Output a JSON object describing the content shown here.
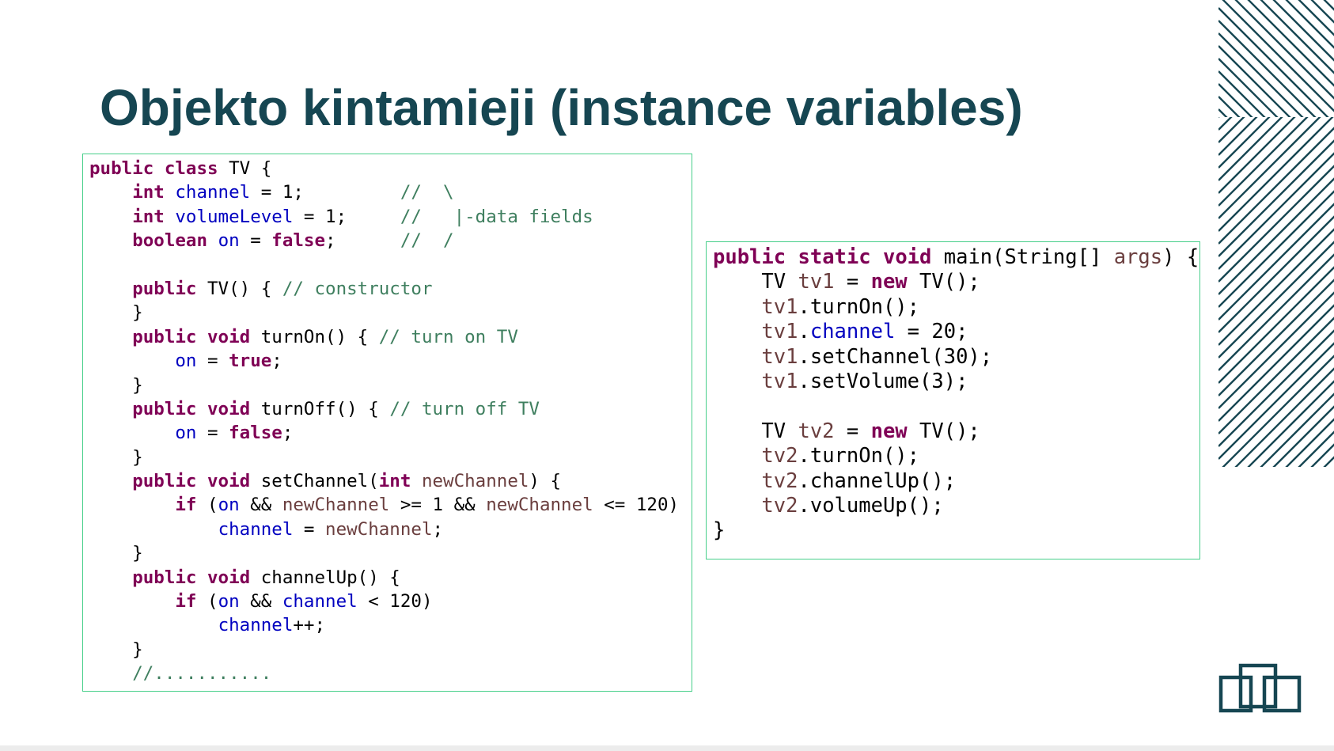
{
  "slide": {
    "title": "Objekto kintamieji (instance variables)"
  },
  "code_class": {
    "l1": {
      "t1": "public",
      "t2": " ",
      "t3": "class",
      "t4": " TV {"
    },
    "l2": {
      "t1": "    ",
      "t2": "int",
      "t3": " ",
      "t4": "channel",
      "t5": " = 1;         ",
      "t6": "//  \\"
    },
    "l3": {
      "t1": "    ",
      "t2": "int",
      "t3": " ",
      "t4": "volumeLevel",
      "t5": " = 1;     ",
      "t6": "//   |-data fields"
    },
    "l4": {
      "t1": "    ",
      "t2": "boolean",
      "t3": " ",
      "t4": "on",
      "t5": " = ",
      "t6": "false",
      "t7": ";      ",
      "t8": "//  /"
    },
    "l5": {
      "t1": ""
    },
    "l6": {
      "t1": "    ",
      "t2": "public",
      "t3": " TV() { ",
      "t4": "// constructor"
    },
    "l7": {
      "t1": "    }"
    },
    "l8": {
      "t1": "    ",
      "t2": "public",
      "t3": " ",
      "t4": "void",
      "t5": " turnOn() { ",
      "t6": "// turn on TV"
    },
    "l9": {
      "t1": "        ",
      "t2": "on",
      "t3": " = ",
      "t4": "true",
      "t5": ";"
    },
    "l10": {
      "t1": "    }"
    },
    "l11": {
      "t1": "    ",
      "t2": "public",
      "t3": " ",
      "t4": "void",
      "t5": " turnOff() { ",
      "t6": "// turn off TV"
    },
    "l12": {
      "t1": "        ",
      "t2": "on",
      "t3": " = ",
      "t4": "false",
      "t5": ";"
    },
    "l13": {
      "t1": "    }"
    },
    "l14": {
      "t1": "    ",
      "t2": "public",
      "t3": " ",
      "t4": "void",
      "t5": " setChannel(",
      "t6": "int",
      "t7": " ",
      "t8": "newChannel",
      "t9": ") {"
    },
    "l15": {
      "t1": "        ",
      "t2": "if",
      "t3": " (",
      "t4": "on",
      "t5": " && ",
      "t6": "newChannel",
      "t7": " >= 1 && ",
      "t8": "newChannel",
      "t9": " <= 120)"
    },
    "l16": {
      "t1": "            ",
      "t2": "channel",
      "t3": " = ",
      "t4": "newChannel",
      "t5": ";"
    },
    "l17": {
      "t1": "    }"
    },
    "l18": {
      "t1": "    ",
      "t2": "public",
      "t3": " ",
      "t4": "void",
      "t5": " channelUp() {"
    },
    "l19": {
      "t1": "        ",
      "t2": "if",
      "t3": " (",
      "t4": "on",
      "t5": " && ",
      "t6": "channel",
      "t7": " < 120)"
    },
    "l20": {
      "t1": "            ",
      "t2": "channel",
      "t3": "++;"
    },
    "l21": {
      "t1": "    }"
    },
    "l22": {
      "t1": "    ",
      "t2": "//..........."
    }
  },
  "code_main": {
    "l1": {
      "t1": "public",
      "t2": " ",
      "t3": "static",
      "t4": " ",
      "t5": "void",
      "t6": " main(String[] ",
      "t7": "args",
      "t8": ") {"
    },
    "l2": {
      "t1": "    TV ",
      "t2": "tv1",
      "t3": " = ",
      "t4": "new",
      "t5": " TV();"
    },
    "l3": {
      "t1": "    ",
      "t2": "tv1",
      "t3": ".turnOn();"
    },
    "l4": {
      "t1": "    ",
      "t2": "tv1",
      "t3": ".",
      "t4": "channel",
      "t5": " = 20;"
    },
    "l5": {
      "t1": "    ",
      "t2": "tv1",
      "t3": ".setChannel(30);"
    },
    "l6": {
      "t1": "    ",
      "t2": "tv1",
      "t3": ".setVolume(3);"
    },
    "l7": {
      "t1": ""
    },
    "l8": {
      "t1": "    TV ",
      "t2": "tv2",
      "t3": " = ",
      "t4": "new",
      "t5": " TV();"
    },
    "l9": {
      "t1": "    ",
      "t2": "tv2",
      "t3": ".turnOn();"
    },
    "l10": {
      "t1": "    ",
      "t2": "tv2",
      "t3": ".channelUp();"
    },
    "l11": {
      "t1": "    ",
      "t2": "tv2",
      "t3": ".volumeUp();"
    },
    "l12": {
      "t1": "}"
    }
  },
  "colors": {
    "title": "#164652",
    "keyword": "#7f0055",
    "field": "#0000c0",
    "comment": "#3f7f5f",
    "local_variable": "#6a3e3e",
    "box_border": "#47cf8a",
    "decoration": "#164652"
  },
  "icons": {
    "stripes": "diagonal-stripes-decoration-icon",
    "logo": "logo-icon"
  }
}
